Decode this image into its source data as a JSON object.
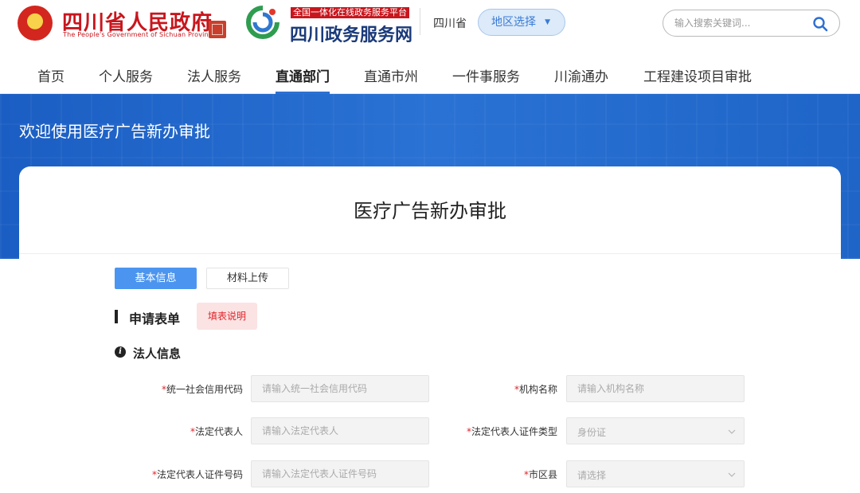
{
  "header": {
    "gov_title": "四川省人民政府",
    "gov_subtitle": "The People's Government of Sichuan Province",
    "service_tagline": "全国一体化在线政务服务平台",
    "service_name": "四川政务服务网",
    "province": "四川省",
    "region_button": "地区选择",
    "search_placeholder": "输入搜索关键词..."
  },
  "nav": {
    "items": [
      "首页",
      "个人服务",
      "法人服务",
      "直通部门",
      "直通市州",
      "一件事服务",
      "川渝通办",
      "工程建设项目审批"
    ],
    "active_index": 3
  },
  "banner": {
    "title": "欢迎使用医疗广告新办审批"
  },
  "card": {
    "title": "医疗广告新办审批",
    "tabs": [
      "基本信息",
      "材料上传"
    ],
    "section_title": "申请表单",
    "fill_instructions": "填表说明",
    "subsection_title": "法人信息"
  },
  "form": {
    "credit_code": {
      "label": "统一社会信用代码",
      "placeholder": "请输入统一社会信用代码"
    },
    "org_name": {
      "label": "机构名称",
      "placeholder": "请输入机构名称"
    },
    "legal_rep": {
      "label": "法定代表人",
      "placeholder": "请输入法定代表人"
    },
    "id_type": {
      "label": "法定代表人证件类型",
      "value": "身份证"
    },
    "id_number": {
      "label": "法定代表人证件号码",
      "placeholder": "请输入法定代表人证件号码"
    },
    "district": {
      "label": "市区县",
      "value": "请选择"
    },
    "required_mark": "*"
  },
  "colors": {
    "brand_blue": "#2d6fd3",
    "gov_red": "#c8161d",
    "tab_blue": "#4b95f0"
  }
}
